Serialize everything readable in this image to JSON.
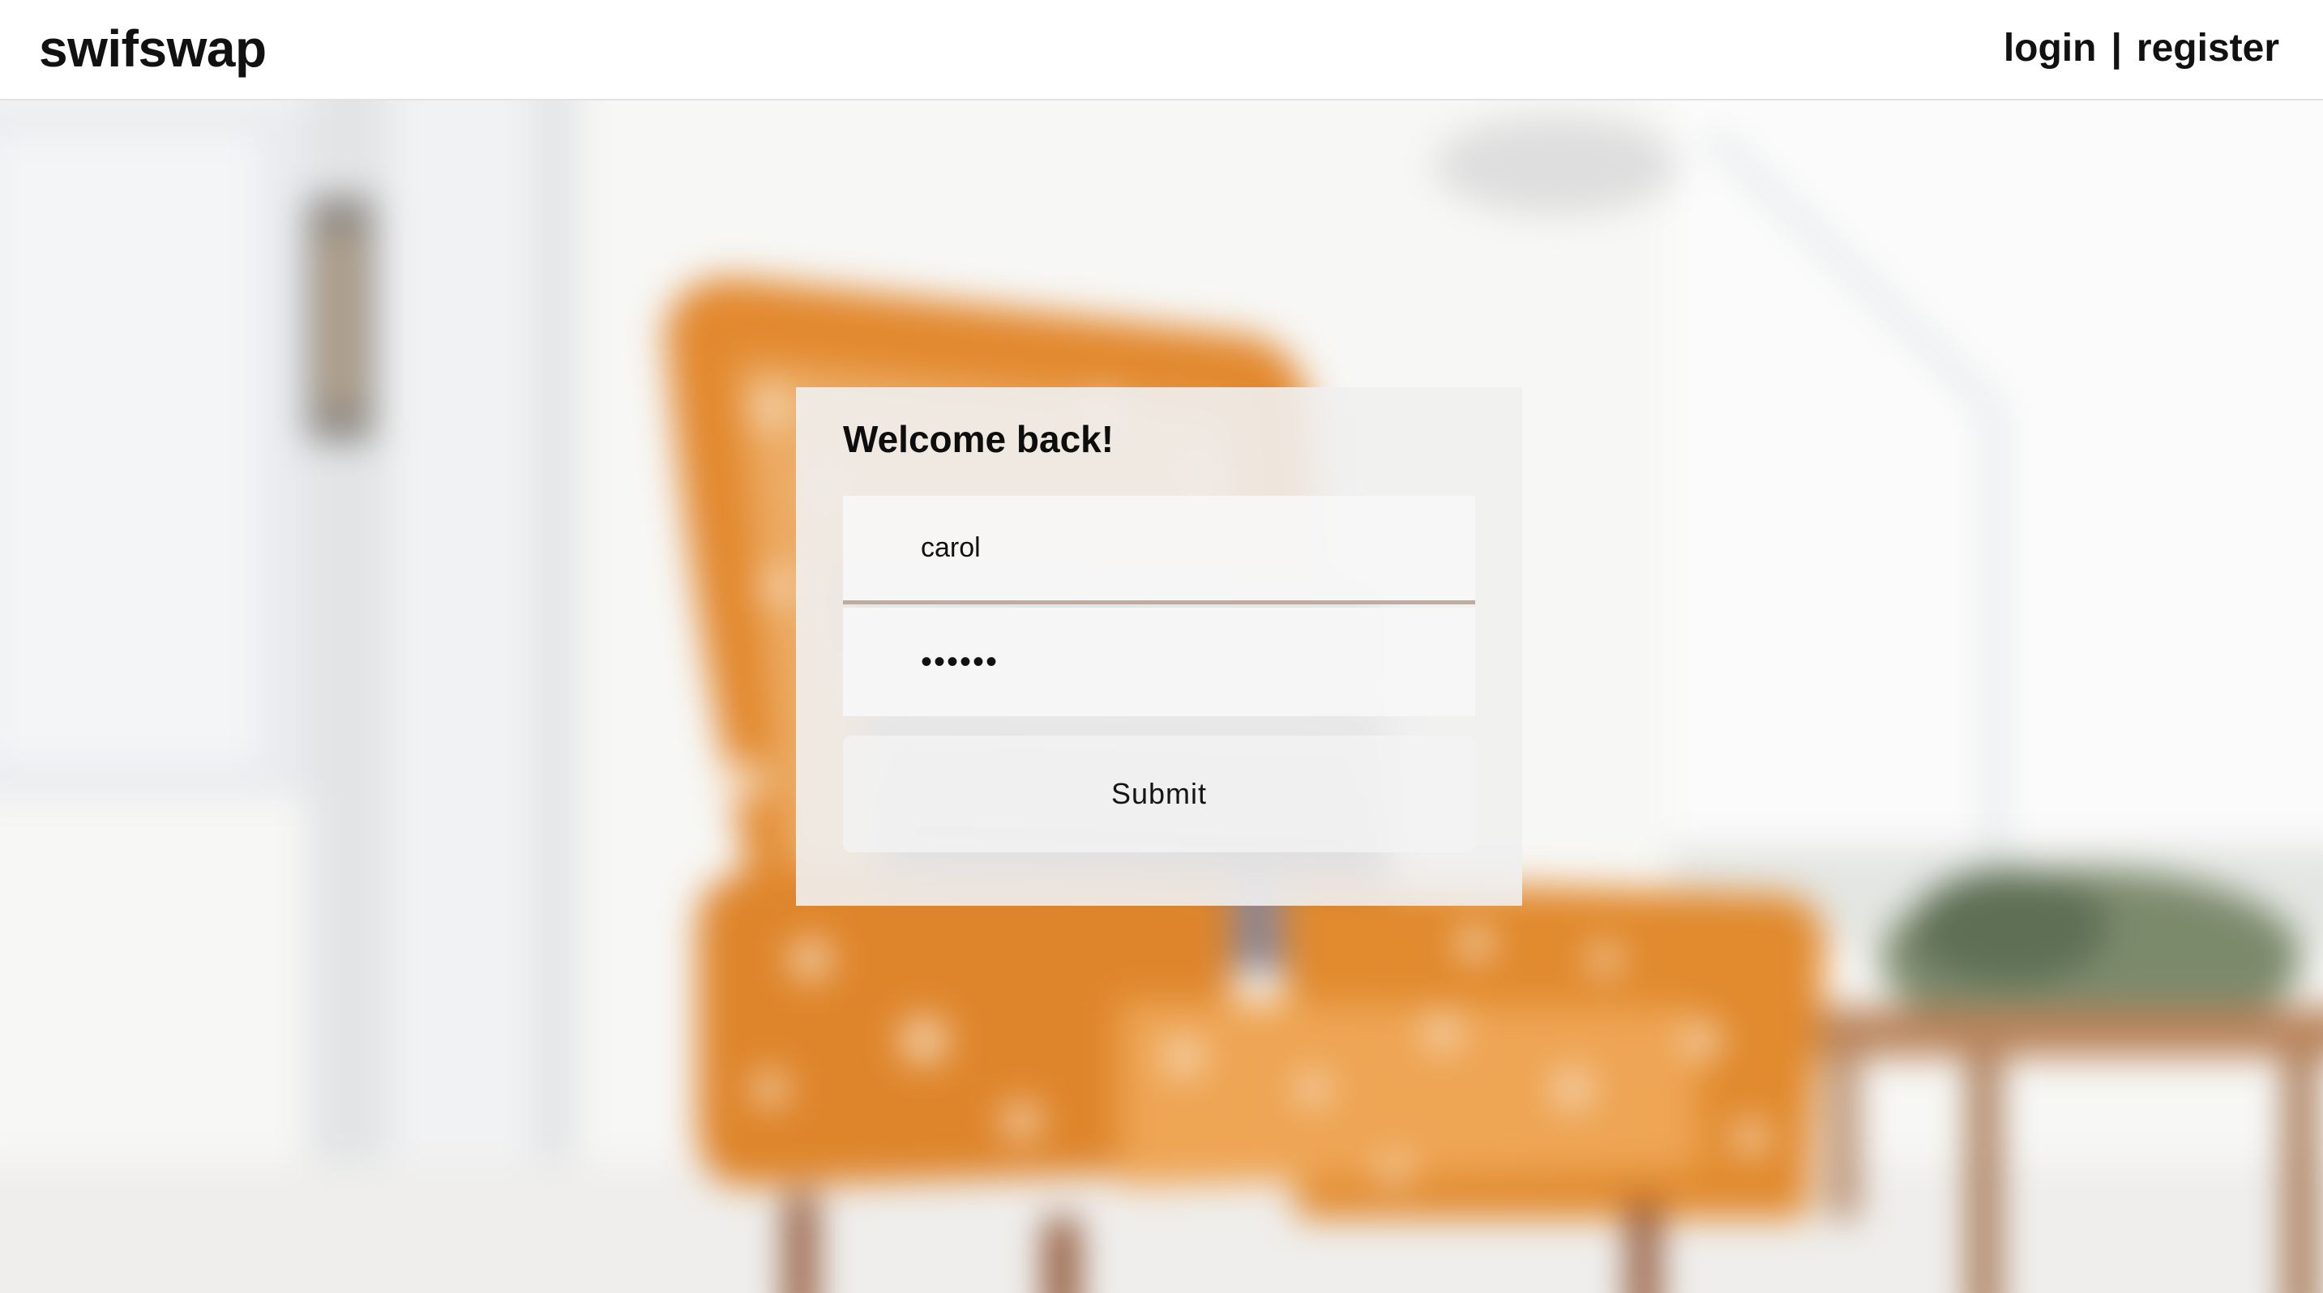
{
  "header": {
    "brand": "swifswap",
    "nav_login": "login",
    "nav_separator": "|",
    "nav_register": "register"
  },
  "login_card": {
    "title": "Welcome back!",
    "username_value": "carol",
    "password_value": "••••••",
    "submit_label": "Submit"
  },
  "colors": {
    "header_bg": "#ffffff",
    "card_bg": "#f0f0f0",
    "chair_orange": "#e08a2c",
    "text": "#111111"
  }
}
